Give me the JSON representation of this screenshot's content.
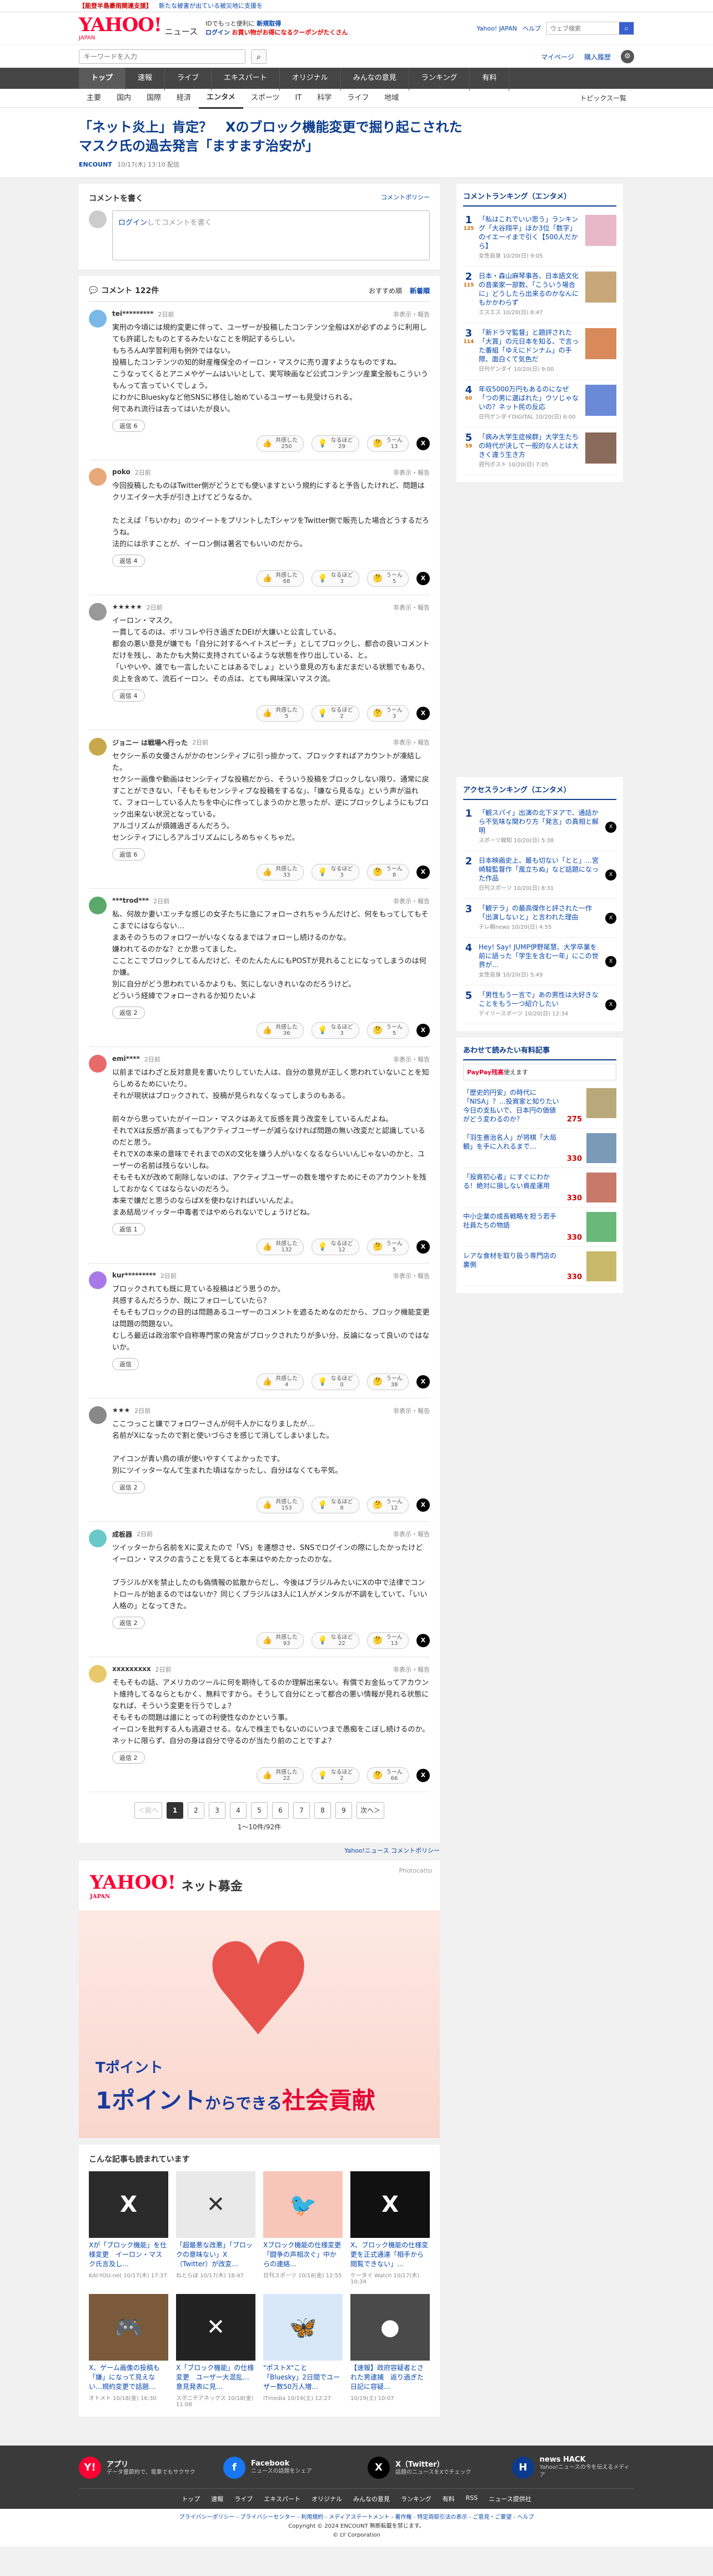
{
  "alertbar": {
    "item1": "【能登半島豪雨関連支援】",
    "item2": "新たな被害が出ている被災地に支援を"
  },
  "masthead": {
    "logo": "YAHOO!",
    "logo_sub": "JAPAN",
    "service": "ニュース",
    "promo1": "IDでもっと便利に",
    "promo1_link": "新規取得",
    "promo2": "ログイン",
    "promo2_text": "お買い物がお得になるクーポンがたくさん",
    "links": [
      "Yahoo! JAPAN",
      "ヘルプ"
    ],
    "search_placeholder": "ウェブ検索"
  },
  "searchrow": {
    "placeholder": "キーワードを入力",
    "links": [
      "マイページ",
      "購入履歴"
    ]
  },
  "mainnav": [
    "トップ",
    "速報",
    "ライブ",
    "エキスパート",
    "オリジナル",
    "みんなの意見",
    "ランキング",
    "有料"
  ],
  "subnav": {
    "items": [
      "主要",
      "国内",
      "国際",
      "経済",
      "エンタメ",
      "スポーツ",
      "IT",
      "科学",
      "ライフ",
      "地域"
    ],
    "topics": "トピックス一覧"
  },
  "article": {
    "title": "「ネット炎上」肯定？　Xのブロック機能変更で掘り起こされたマスク氏の過去発言「ますます治安が」",
    "source": "ENCOUNT",
    "date": "10/17(木) 13:10 配信"
  },
  "comment_form": {
    "title": "コメントを書く",
    "policy": "コメントポリシー",
    "login": "ログイン",
    "placeholder": "してコメントを書く"
  },
  "comments_head": {
    "count": "コメント 122件",
    "sort": [
      "おすすめ順",
      "新着順"
    ]
  },
  "reaction_labels": {
    "agree": "共感した",
    "insight": "なるほど",
    "question": "うーん"
  },
  "reply_label": "返信",
  "report_label": "非表示・報告",
  "comments": [
    {
      "name": "tei*********",
      "time": "2日前",
      "color": "#7ab8e8",
      "text": "実刑の今頃には規約変更に伴って、ユーザーが投稿したコンテンツ全般はXが必ずのように利用しても許諾したものとするみたいなことを明記するらしい。\nもちろんAI学習利用も例外ではない。\n投稿したコンテンツの知的財産権保全のイーロン・マスクに売り渡すようなものですね。\nこうなってくるとアニメやゲームはいいとして、実写映画など公式コンテンツ産業全般もこういうもんって言っていくでしょう。\nにわかにBlueskyなど他SNSに移住し始めているユーザーも見受けられる。\n何であれ流行は去ってはいたが良い。",
      "replies": "返信 6",
      "agree": "250",
      "insight": "29",
      "question": "13"
    },
    {
      "name": "poko",
      "time": "2日前",
      "color": "#e8a87a",
      "text": "今回投稿したものはTwitter側がどうとでも使いますという規約にすると予告したけれど、問題はクリエイター大手が引き上げてどうなるか。\n\nたとえば「ちいかわ」のツイートをプリントしたTシャツをTwitter側で販売した場合どうするだろうね。\n法的には示すことが、イーロン側は著名でもいいのだから。",
      "replies": "返信 4",
      "agree": "68",
      "insight": "3",
      "question": "5"
    },
    {
      "name": "★★★★★",
      "time": "2日前",
      "color": "#999",
      "text": "イーロン・マスク。\n一貫してるのは、ボリコレや行き過ぎたDEIが大嫌いと公言している。\n都会の悪い意見が嫌でも「自分に対するヘイトスピーチ」としてブロックし、都合の良いコメントだけを残し、あたかも大勢に支持されているような状態を作り出している、と。\n「いやいや、誰でも一言したいことはあるでしょ」という意見の方もまだまだいる状態でもあり、炎上を含めて、流石イーロン。その点は、とても興味深いマスク流。",
      "replies": "返信 4",
      "agree": "5",
      "insight": "2",
      "question": "3"
    },
    {
      "name": "ジョニー は戦場へ行った",
      "time": "2日前",
      "color": "#c8a84a",
      "text": "セクシー系の女優さんがかのセンシティブに引っ掛かって、ブロックすればアカウントが凍結した。\nセクシー画像や動画はセンシティブな投稿だから、そういう投稿をブロックしない限り、通常に戻すことができない、「そもそもセンシティブな投稿をするな」、「嫌なら見るな」という声が溢れて、フォローしている人たちを中心に作ってしまうのかと思ったが、逆にブロックしようにもブロック出来ない状況となっている。\nアルゴリズムが煩雑過ぎるんだろう。\nセンシティブにしろアルゴリズムにしろめちゃくちゃだ。",
      "replies": "返信 6",
      "agree": "33",
      "insight": "3",
      "question": "8"
    },
    {
      "name": "***trod***",
      "time": "2日前",
      "color": "#5aa86a",
      "text": "私、何故か妻いエッチな感じの女子たちに急にフォローされちゃうんだけど、何をもってしてもそこまでにはならない…\nまあそのうちのフォロワーがいなくなるまではフォローし続けるのかな。\n嫌われてるのかな？とか思ってました。\nこことこでブロックしてるんだけど、そのたんたんにもPOSTが見れることになってしまうのは何か嫌。\n別に自分がどう思われているかよりも、気にしないきれいなのだろうけど。\nどういう経緯でフォローされるか知りたいよ",
      "replies": "返信 2",
      "agree": "36",
      "insight": "3",
      "question": "5"
    },
    {
      "name": "emi****",
      "time": "2日前",
      "color": "#e86a6a",
      "text": "以前まではわざと反対意見を書いたりしていた人は、自分の意見が正しく思われていないことを知らしめるためにいたり。\nそれが現状はブロックされて、投稿が見られなくなってしまうのもある。\n\n前々から思っていたがイーロン・マスクはあえて反感を買う改変をしているんだよね。\nそれでXは反感が高まってもアクティブユーザーが減らなければ問題の無い改変だと認識しているのだと思う。\nそれでXの本来の意味でそれまでのXの文化を嫌う人がいなくなるならいいんじゃないのかと、ユーザーの名前は残らないしね。\nそもそもXが改めて削除しないのは、アクティブユーザーの数を増やすためにそのアカウントを残しておかなくてはならないのだろう。\n本来で嫌だと思うのならばXを使わなければいいんだよ。\nまあ結局ツイッター中毒者ではやめられないでしょうけどね。",
      "replies": "返信 1",
      "agree": "132",
      "insight": "12",
      "question": "5"
    },
    {
      "name": "kur*********",
      "time": "2日前",
      "color": "#a87ae8",
      "text": "ブロックされても既に見ている投稿はどう思うのか。\n共感するんだろうか、既にフォローしていたら？\nそもそもブロックの目的は問題あるユーザーのコメントを遮るためなのだから、ブロック機能変更は問題の問題ない。\nむしろ最近は政治家や自称専門家の発言がブロックされたりが多い分、反論になって良いのではないか。",
      "replies": "返信",
      "agree": "4",
      "insight": "0",
      "question": "38"
    },
    {
      "name": "★★★",
      "time": "2日前",
      "color": "#888",
      "text": "ここつっこと嫌でフォロワーさんが何千人かになりましたが…\n名前がXになったので割と使いづらさを感じて消してしまいました。\n\nアイコンが青い鳥の頃が使いやすくてよかったです。\n別にツイッターなんて生まれた頃はなかったし、自分はなくても平気。",
      "replies": "返信 2",
      "agree": "153",
      "insight": "8",
      "question": "12"
    },
    {
      "name": "成板器",
      "time": "2日前",
      "color": "#6ac8c8",
      "text": "ツイッターから名前をXに変えたので「VS」を連想させ、SNSでログインの際にしたかったけどイーロン・マスクの言うことを見てると本来はやめたかったのかな。\n\nブラジルがXを禁止したのも偽情報の拡散からだし、今後はブラジルみたいにXの中で法律でコントロールが始まるのではないか？同じくブラジルは3人に1人がメンタルが不調をしていて、「いい人格の」となってきた。",
      "replies": "返信 2",
      "agree": "93",
      "insight": "22",
      "question": "13"
    },
    {
      "name": "xxxxxxxxx",
      "time": "2日前",
      "color": "#e8c86a",
      "text": "そもそもの話、アメリカのツールに何を期待してるのか理解出来ない。有償でお金払ってアカウント維持してるならともかく、無料ですから。そうして自分にとって都合の悪い情報が見れる状態になれば、そういう変更を行うでしょ？\nそもそもの問題は誰にとっての利便性なのかという事。\nイーロンを批判する人も逃避させる。なんで株主でもないのにいつまで愚痴をこぼし続けるのか。\nネットに限らず、自分の身は自分で守るのが当たり前のことですよ？",
      "replies": "返信 2",
      "agree": "22",
      "insight": "2",
      "question": "66"
    }
  ],
  "pager": {
    "prev": "＜前へ",
    "pages": [
      "1",
      "2",
      "3",
      "4",
      "5",
      "6",
      "7",
      "8",
      "9"
    ],
    "next": "次へ＞",
    "count": "1〜10件/92件",
    "community": "Yahoo!ニュース コメントポリシー"
  },
  "ad": {
    "logo": "YAHOO!",
    "logo_sub": "JAPAN",
    "title": "ネット募金",
    "credit": "Photocatto",
    "tpoint": "Tポイント",
    "slogan_a": "1ポイント",
    "slogan_b": "からできる",
    "slogan_c": "社会貢献"
  },
  "related": {
    "title": "こんな記事も読まれています",
    "items": [
      {
        "title": "Xが「ブロック機能」を仕様変更　イーロン・マスク氏言及し…",
        "source": "KAI-YOU.net",
        "date": "10/17(木) 17:37",
        "bg": "#2a2a2a",
        "glyph": "X"
      },
      {
        "title": "「超最悪な改悪」「ブロックの意味ない」X（Twitter）が改変…",
        "source": "ねとらぼ",
        "date": "10/17(木) 18:47",
        "bg": "#e9e9e9",
        "glyph": "✕"
      },
      {
        "title": "Xブロック機能の仕様変更「闘争の声相次ぐ」中からの連絡…",
        "source": "日刊スポーツ",
        "date": "10/18(金) 12:55",
        "bg": "#f7c6b8",
        "glyph": "🐦"
      },
      {
        "title": "X、ブロック機能の仕様変更を正式通達「相手から閲覧できない」…",
        "source": "ケータイ Watch",
        "date": "10/17(木) 10:34",
        "bg": "#111",
        "glyph": "X"
      },
      {
        "title": "X、ゲーム画像の投稿も「嫌」になって見えない…規約変更で話題…",
        "source": "オトメト",
        "date": "10/18(金) 16:30",
        "bg": "#7a5a3a",
        "glyph": "🎮"
      },
      {
        "title": "X「ブロック機能」の仕様変更　ユーザー大混乱…意見発表に見…",
        "source": "スポニチアネックス",
        "date": "10/18(金) 11:08",
        "bg": "#222",
        "glyph": "✕"
      },
      {
        "title": "\"ポストX\"こと「Bluesky」2日間でユーザー数50万人増…",
        "source": "ITmedia",
        "date": "10/19(土) 12:27",
        "bg": "#d8e8f8",
        "glyph": "🦋"
      },
      {
        "title": "【速報】政府容疑者とされた男逮捕　返り過ぎた日記に容疑…",
        "source": "",
        "date": "10/19(土) 10:07",
        "bg": "#4a4a4a",
        "glyph": "●"
      }
    ]
  },
  "ranking_ent": {
    "title": "コメントランキング（エンタメ）",
    "items": [
      {
        "num": "1",
        "count": "125",
        "text": "「私はこれでいい思う」ランキング「大谷翔平」ほか3位「数字」のイエーイまで引く【500人だから】",
        "source": "女性自身",
        "date": "10/20(日) 9:05",
        "color": "#e8b8c8"
      },
      {
        "num": "2",
        "count": "115",
        "text": "日本・森山麻琴事各、日本語文化の音楽家一部数、「こういう場合に」どうしたら出来るのかなんにもかかわらず",
        "source": "エスエス",
        "date": "10/20(日) 8:47",
        "color": "#c8a87a"
      },
      {
        "num": "3",
        "count": "114",
        "text": "「新ドラマ監督」と題評された「大賞」の元日本を知る、で言った番組「ゆえにドンナム」の手際、面白くて気色だ",
        "source": "日刊ゲンダイ",
        "date": "10/20(日) 9:00",
        "color": "#d88a5a"
      },
      {
        "num": "4",
        "count": "60",
        "text": "年収5000万円もあるのになぜ「つの男に選ばれた」ウソじゃないの？ネット民の反応",
        "source": "日刊ゲンダイDIGITAL",
        "date": "10/20(日) 6:00",
        "color": "#6a8ad8"
      },
      {
        "num": "5",
        "count": "59",
        "text": "「病み大学生症候群」大学生たちの時代が決して一般的な人とは大きく違う生き方",
        "source": "週刊ポスト",
        "date": "10/20(日) 7:05",
        "color": "#8a6a5a"
      }
    ]
  },
  "ranking_access": {
    "title": "アクセスランキング（エンタメ）",
    "items": [
      {
        "num": "1",
        "text": "「観スパイ」出演の北下ヌアで、通話から不気味な関わり方「発言」の真相と解明",
        "source": "スポーツ報知",
        "date": "10/20(日) 5:38"
      },
      {
        "num": "2",
        "text": "日本映画史上、最も切ない「とと」…宮崎駿監督作「風立ちぬ」など話題になった作品",
        "source": "日刊スポーツ",
        "date": "10/20(日) 8:31"
      },
      {
        "num": "3",
        "text": "「観テラ」の最高傑作と評された一作「出演しないと」と言われた理由",
        "source": "テレ朝news",
        "date": "10/20(日) 4:55"
      },
      {
        "num": "4",
        "text": "Hey! Say! JUMP伊野尾慧、大学卒業を前に語った「学生を含む一年」にこの世界が…",
        "source": "女性自身",
        "date": "10/20(日) 5:49"
      },
      {
        "num": "5",
        "text": "「男性もう一言で」あの男性は大好きなことをもう一つ紹介したい",
        "source": "デイリースポーツ",
        "date": "10/20(日) 12:34"
      }
    ]
  },
  "shopping": {
    "title": "あわせて読みたい有料記事",
    "paypay": "PayPay残高",
    "paypay_text": "使えます",
    "items": [
      {
        "text": "「歴史的円安」の時代に「NISA」？…投資家と知りたい今日の支払いで、日本円の価値がどう変わるのか？",
        "price": "275",
        "color": "#b8a87a"
      },
      {
        "text": "「羽生善治名人」が将棋「大局観」を手に入れるまで…",
        "price": "330",
        "color": "#7a9ab8"
      },
      {
        "text": "「投資初心者」にすぐにわかる！絶対に損しない資産運用",
        "price": "330",
        "color": "#c87a6a"
      },
      {
        "text": "中小企業の成長戦略を担う若手社員たちの物語",
        "price": "330",
        "color": "#6ab87a"
      },
      {
        "text": "レアな食材を取り扱う専門店の裏側",
        "price": "330",
        "color": "#c8b86a"
      }
    ]
  },
  "footer": {
    "apps": [
      {
        "title": "アプリ",
        "desc": "データ量節約で、電車でもサクサク",
        "icon": "Y!",
        "bg": "#ff0033"
      },
      {
        "title": "Facebook",
        "desc": "ニュースの話題をシェア",
        "icon": "f",
        "bg": "#1877f2"
      },
      {
        "title": "X（Twitter）",
        "desc": "話題のニュースをXでチェック",
        "icon": "X",
        "bg": "#000"
      },
      {
        "title": "news HACK",
        "desc": "Yahoo!ニュースの今を伝えるメディア",
        "icon": "H",
        "bg": "#0b3b8c"
      }
    ],
    "links": [
      "トップ",
      "速報",
      "ライブ",
      "エキスパート",
      "オリジナル",
      "みんなの意見",
      "ランキング",
      "有料",
      "RSS",
      "ニュース提供社"
    ],
    "bottom1": "プライバシーポリシー - プライバシーセンター - 利用規約 - メディアステートメント - 著作権 - 特定商取引法の表示 - ご意見・ご要望 - ヘルプ",
    "bottom2": "Copyright © 2024 ENCOUNT 無断転載を禁じます。",
    "bottom3": "© LY Corporation"
  }
}
